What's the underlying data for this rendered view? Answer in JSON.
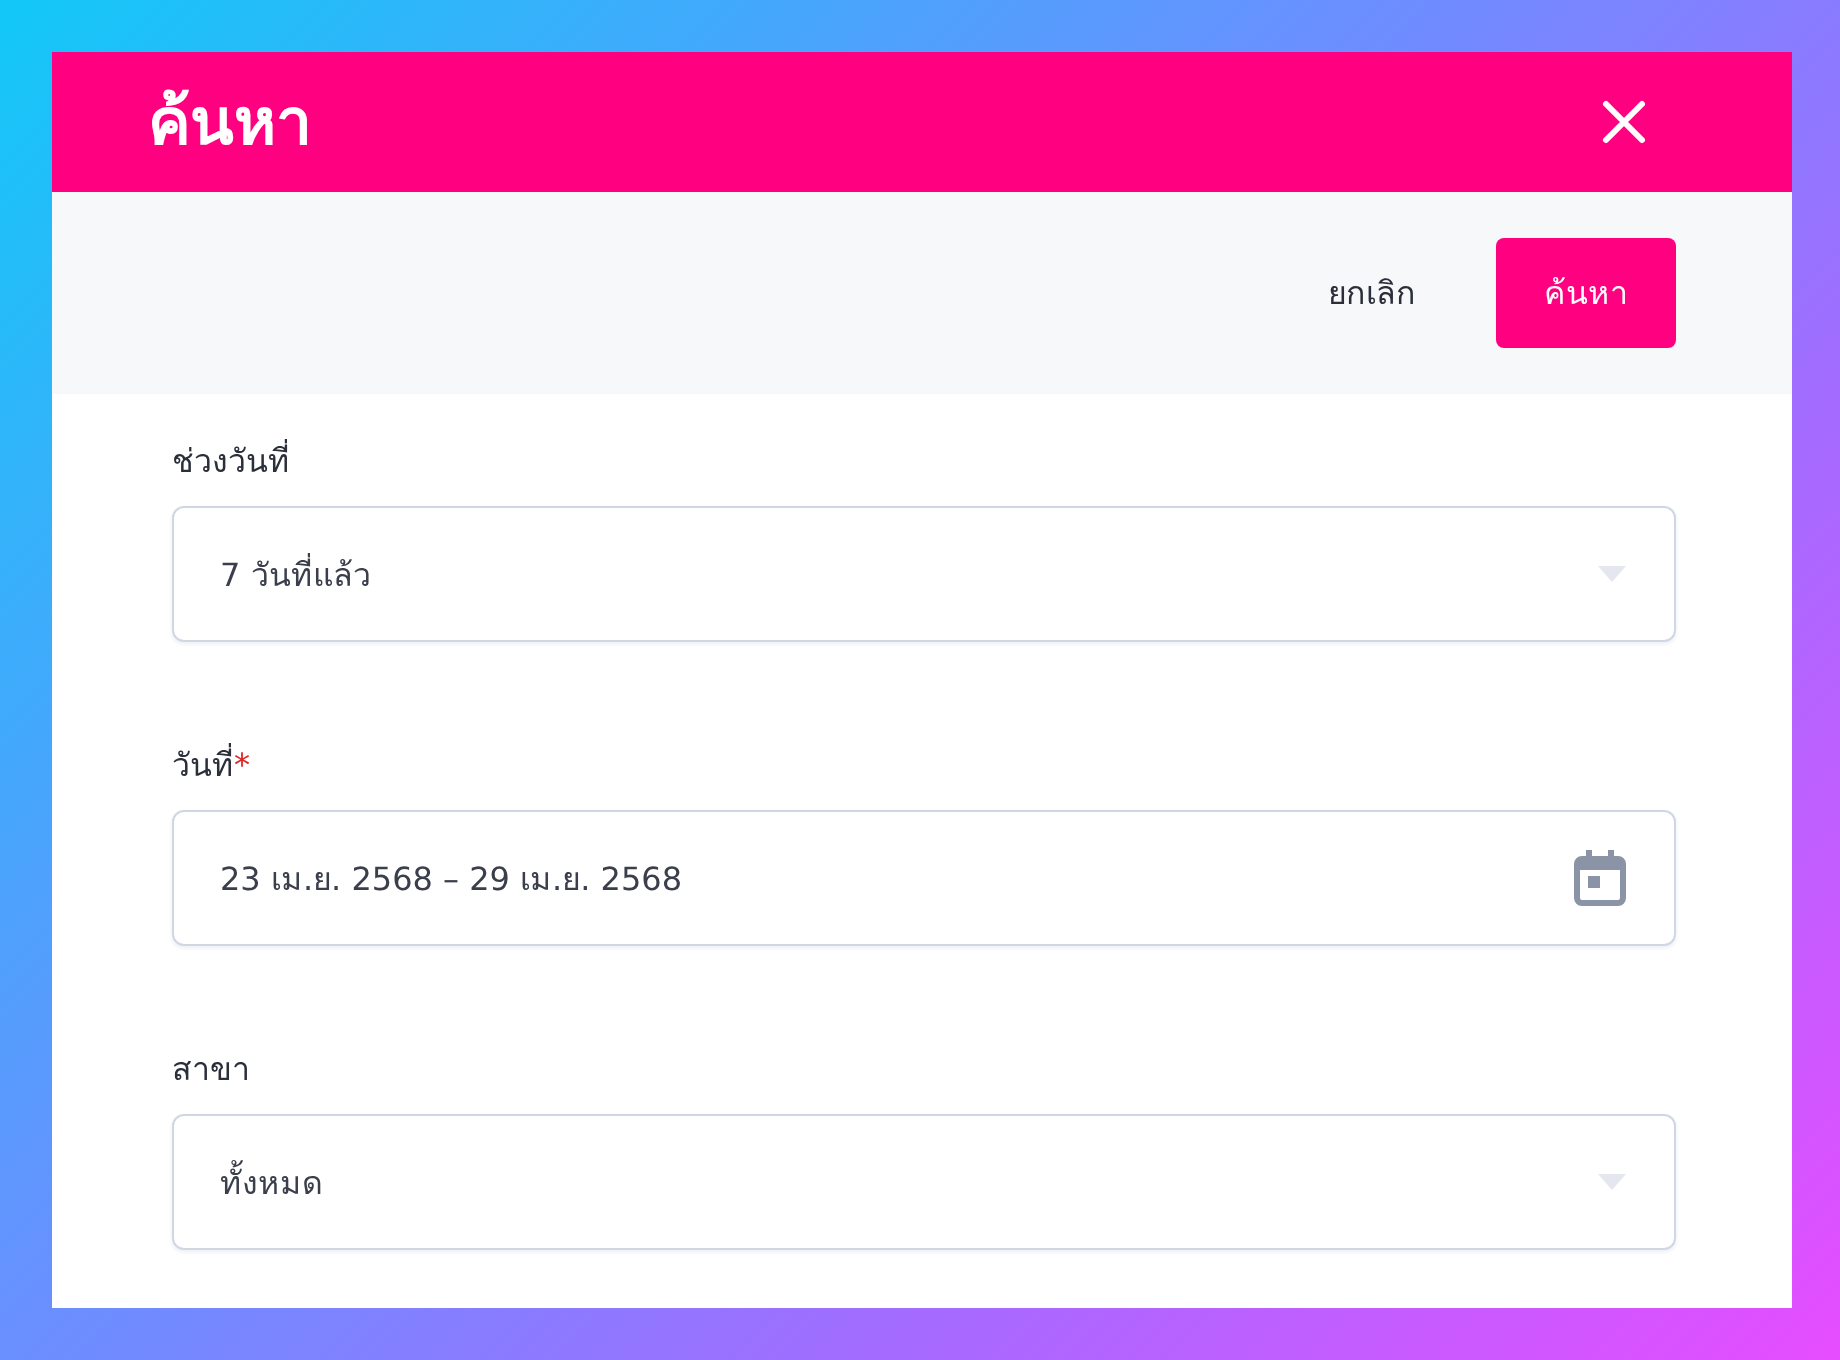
{
  "dialog": {
    "title": "ค้นหา"
  },
  "actions": [
    {
      "kind": "text",
      "label": "ยกเลิก"
    },
    {
      "kind": "primary",
      "label": "ค้นหา"
    }
  ],
  "fields": [
    {
      "kind": "select",
      "label": "ช่วงวันที่",
      "value": "7 วันที่แล้ว"
    },
    {
      "kind": "date_range",
      "label": "วันที่",
      "required_mark": "*",
      "value": "23 เม.ย. 2568 – 29 เม.ย. 2568"
    },
    {
      "kind": "select",
      "label": "สาขา",
      "value": "ทั้งหมด"
    }
  ]
}
